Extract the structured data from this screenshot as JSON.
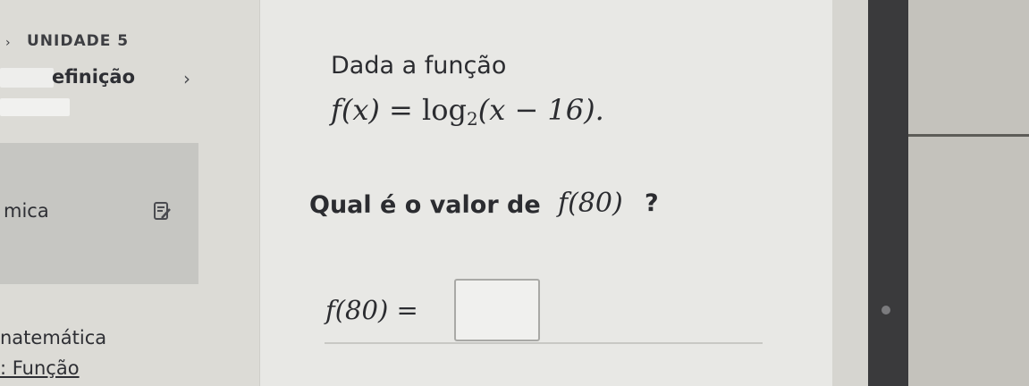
{
  "sidebar": {
    "unit_heading": "UNIDADE 5",
    "definition_label": "efinição",
    "active_item_label": "mica",
    "course_label": "natemática",
    "topic_link": ": Função"
  },
  "exercise": {
    "intro": "Dada a função",
    "function_lhs": "f(x)",
    "function_equals": "=",
    "function_log": "log",
    "function_base": "2",
    "function_arg": "(x − 16).",
    "question_text": "Qual é o valor de",
    "question_math": "f(80)",
    "question_mark": "?",
    "answer_lhs": "f(80) =",
    "answer_value": ""
  },
  "icons": {
    "unit_chevron": "chevron-right-icon",
    "definition_chevron": "chevron-right-icon",
    "edit": "edit-note-icon"
  },
  "colors": {
    "sidebar_bg": "#dcdbd6",
    "main_bg": "#e8e8e5",
    "text": "#2b2c30"
  }
}
